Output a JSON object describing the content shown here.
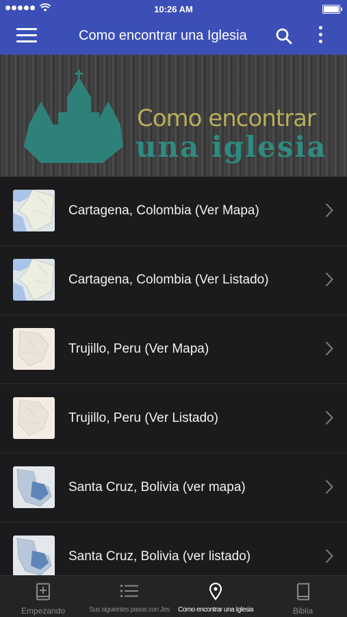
{
  "status_bar": {
    "time": "10:26 AM"
  },
  "app_bar": {
    "title": "Como encontrar una Iglesia"
  },
  "banner": {
    "line1": "Como encontrar",
    "line2": "una iglesia"
  },
  "items": [
    {
      "label": "Cartagena, Colombia (Ver Mapa)",
      "thumb": "colombia-map"
    },
    {
      "label": "Cartagena, Colombia (Ver Listado)",
      "thumb": "colombia-map"
    },
    {
      "label": "Trujillo, Peru (Ver Mapa)",
      "thumb": "peru-map"
    },
    {
      "label": "Trujillo, Peru (Ver Listado)",
      "thumb": "peru-map"
    },
    {
      "label": "Santa Cruz, Bolivia (ver mapa)",
      "thumb": "bolivia-map"
    },
    {
      "label": "Santa Cruz, Bolivia (ver listado)",
      "thumb": "bolivia-map"
    }
  ],
  "tabs": [
    {
      "label": "Empezando",
      "icon": "bible-plus-icon"
    },
    {
      "label": "Sus siguientes pasos con Jes",
      "icon": "list-icon"
    },
    {
      "label": "Como encontrar una Iglesia",
      "icon": "location-pin-icon",
      "active": true
    },
    {
      "label": "Biblia",
      "icon": "book-icon"
    }
  ],
  "colors": {
    "primary": "#3b4fb6",
    "background": "#1b1b1d",
    "tabbar": "#242426",
    "banner_gold": "#b9ad5a",
    "banner_teal": "#2f8a80"
  }
}
